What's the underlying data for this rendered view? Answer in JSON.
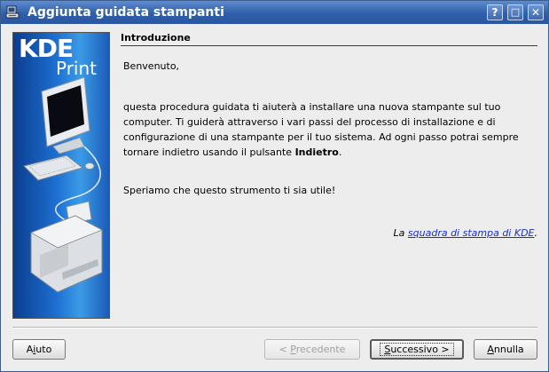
{
  "window": {
    "title": "Aggiunta guidata stampanti",
    "controls": {
      "help": "?",
      "maximize": "□",
      "close": "✕"
    }
  },
  "side_panel": {
    "logo_top": "KDE",
    "logo_bottom": "Print"
  },
  "page": {
    "section_title": "Introduzione",
    "welcome": "Benvenuto,",
    "intro_before_bold": "questa procedura guidata ti aiuterà a installare una nuova stampante sul tuo computer. Ti guiderà attraverso i vari passi del processo di installazione e di configurazione di una stampante per il tuo sistema. Ad ogni passo potrai sempre tornare indietro usando il pulsante ",
    "intro_bold": "Indietro",
    "intro_after_bold": ".",
    "hope": "Speriamo che questo strumento ti sia utile!",
    "credit_prefix": "La ",
    "credit_link": "squadra di stampa di KDE",
    "credit_suffix": "."
  },
  "buttons": {
    "help_pre": "A",
    "help_accel": "i",
    "help_post": "uto",
    "back_pre": "< ",
    "back_accel": "P",
    "back_post": "recedente",
    "next_pre": "",
    "next_accel": "S",
    "next_post": "uccessivo >",
    "cancel_pre": "",
    "cancel_accel": "A",
    "cancel_post": "nnulla"
  },
  "colors": {
    "titlebar": "#2f5fa8",
    "side_panel": "#1d6fd1",
    "link": "#1a2fd0"
  }
}
